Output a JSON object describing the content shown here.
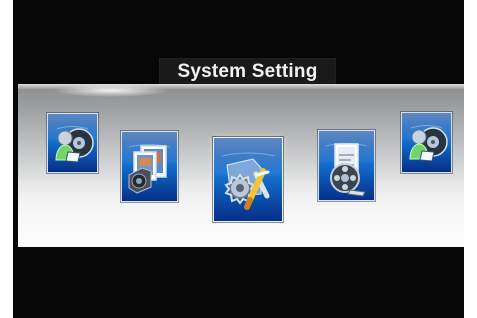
{
  "screen": {
    "title": "System Setting"
  },
  "colors": {
    "frame": "#070707",
    "title_background": "#1a1a1a",
    "title_text": "#f2f2f2",
    "band_top": "#8a8c8e",
    "band_bottom": "#f8f8f8",
    "tile_dark": "#062f87",
    "tile_light": "#1a73cf",
    "tile_border": "#d8e3ee"
  },
  "carousel": {
    "items": [
      {
        "icon": "dvd-user-icon",
        "state": "previous"
      },
      {
        "icon": "photo-camera-icon",
        "state": "previous"
      },
      {
        "icon": "tools-settings-icon",
        "state": "selected"
      },
      {
        "icon": "film-reel-icon",
        "state": "next"
      },
      {
        "icon": "dvd-user-icon",
        "state": "next"
      }
    ]
  }
}
